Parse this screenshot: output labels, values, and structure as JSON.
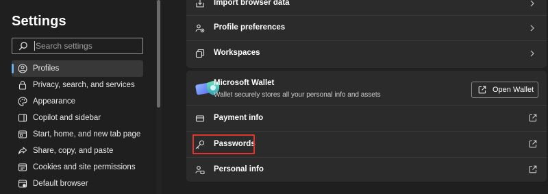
{
  "sidebar": {
    "title": "Settings",
    "search_placeholder": "Search settings",
    "items": [
      {
        "label": "Profiles",
        "icon": "profile-icon",
        "active": true
      },
      {
        "label": "Privacy, search, and services",
        "icon": "lock-icon"
      },
      {
        "label": "Appearance",
        "icon": "palette-icon"
      },
      {
        "label": "Copilot and sidebar",
        "icon": "sidebar-icon"
      },
      {
        "label": "Start, home, and new tab page",
        "icon": "home-tab-icon"
      },
      {
        "label": "Share, copy, and paste",
        "icon": "share-icon"
      },
      {
        "label": "Cookies and site permissions",
        "icon": "cookies-icon"
      },
      {
        "label": "Default browser",
        "icon": "browser-icon"
      }
    ]
  },
  "profile_card": {
    "rows": [
      {
        "label": "Import browser data",
        "icon": "import-icon"
      },
      {
        "label": "Profile preferences",
        "icon": "profile-preferences-icon"
      },
      {
        "label": "Workspaces",
        "icon": "workspaces-icon"
      }
    ]
  },
  "wallet": {
    "title": "Microsoft Wallet",
    "description": "Wallet securely stores all your personal info and assets",
    "button_label": "Open Wallet",
    "rows": [
      {
        "label": "Payment info",
        "icon": "card-icon"
      },
      {
        "label": "Passwords",
        "icon": "key-icon",
        "highlighted": true
      },
      {
        "label": "Personal info",
        "icon": "person-info-icon"
      }
    ]
  },
  "colors": {
    "background": "#1f1f1f",
    "card": "#2b2b2b",
    "accent": "#6cb0f0",
    "highlight": "#e0352b"
  }
}
